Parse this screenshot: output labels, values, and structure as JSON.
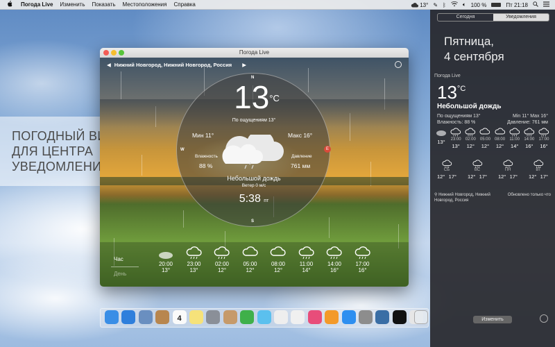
{
  "menubar": {
    "app_name": "Погода Live",
    "items": [
      "Изменить",
      "Показать",
      "Местоположения",
      "Справка"
    ],
    "status_temp": "13°",
    "battery": "100 %",
    "time": "Пт 21:18"
  },
  "notification_center": {
    "tabs": [
      "Сегодня",
      "Уведомления"
    ],
    "day": "Пятница,",
    "date": "4 сентября",
    "widget": {
      "title": "Погода Live",
      "temp": "13",
      "unit": "°C",
      "condition": "Небольшой дождь",
      "feels_like": "По ощущениям 13°",
      "humidity": "Влажность: 88 %",
      "min_max": "Min 11°  Max 16°",
      "pressure": "Давление: 761 мм",
      "hourly": [
        {
          "time": "",
          "temp": "13°",
          "icon": "partly-cloudy-night-icon"
        },
        {
          "time": "23:00",
          "temp": "13°",
          "icon": "rain-icon"
        },
        {
          "time": "02:00",
          "temp": "12°",
          "icon": "rain-icon"
        },
        {
          "time": "05:00",
          "temp": "12°",
          "icon": "cloud-icon"
        },
        {
          "time": "08:00",
          "temp": "12°",
          "icon": "cloud-icon"
        },
        {
          "time": "11:00",
          "temp": "14°",
          "icon": "rain-icon"
        },
        {
          "time": "14:00",
          "temp": "16°",
          "icon": "rain-icon"
        },
        {
          "time": "17:00",
          "temp": "16°",
          "icon": "rain-icon"
        }
      ],
      "daily": [
        {
          "day": "СБ",
          "low": "12°",
          "high": "17°"
        },
        {
          "day": "ВС",
          "low": "12°",
          "high": "17°"
        },
        {
          "day": "ПН",
          "low": "12°",
          "high": "17°"
        },
        {
          "day": "ВТ",
          "low": "12°",
          "high": "17°"
        }
      ],
      "location": "Нижний Новгород, Нижний Новгород, Россия",
      "updated": "Обновлено только что"
    },
    "edit_label": "Изменить"
  },
  "banner": {
    "line1": "ПОГОДНЫЙ ВИДЖЕТ",
    "line2": "ДЛЯ ЦЕНТРА",
    "line3": "УВЕДОМЛЕНИЙ"
  },
  "window": {
    "title": "Погода Live",
    "location": "Нижний Новгород, Нижний Новгород, Россия",
    "temp": "13",
    "unit": "°C",
    "feels_like": "По ощущениям 13°",
    "min": "Мин 11°",
    "max": "Макс 16°",
    "humidity_label": "Влажность",
    "humidity_value": "88 %",
    "pressure_label": "Давление",
    "pressure_value": "761 мм",
    "condition": "Небольшой дождь",
    "wind": "Ветер 0 м/с",
    "time": "5:38",
    "time_suffix": "пт",
    "compass": {
      "n": "N",
      "s": "S",
      "w": "W",
      "e": "E"
    },
    "tab_hour": "Час",
    "tab_day": "День",
    "hourly": [
      {
        "time": "20:00",
        "temp": "13°"
      },
      {
        "time": "23:00",
        "temp": "13°"
      },
      {
        "time": "02:00",
        "temp": "12°"
      },
      {
        "time": "05:00",
        "temp": "12°"
      },
      {
        "time": "08:00",
        "temp": "12°"
      },
      {
        "time": "11:00",
        "temp": "14°"
      },
      {
        "time": "14:00",
        "temp": "16°"
      },
      {
        "time": "17:00",
        "temp": "16°"
      }
    ]
  },
  "dock": {
    "calendar_day": "4"
  }
}
